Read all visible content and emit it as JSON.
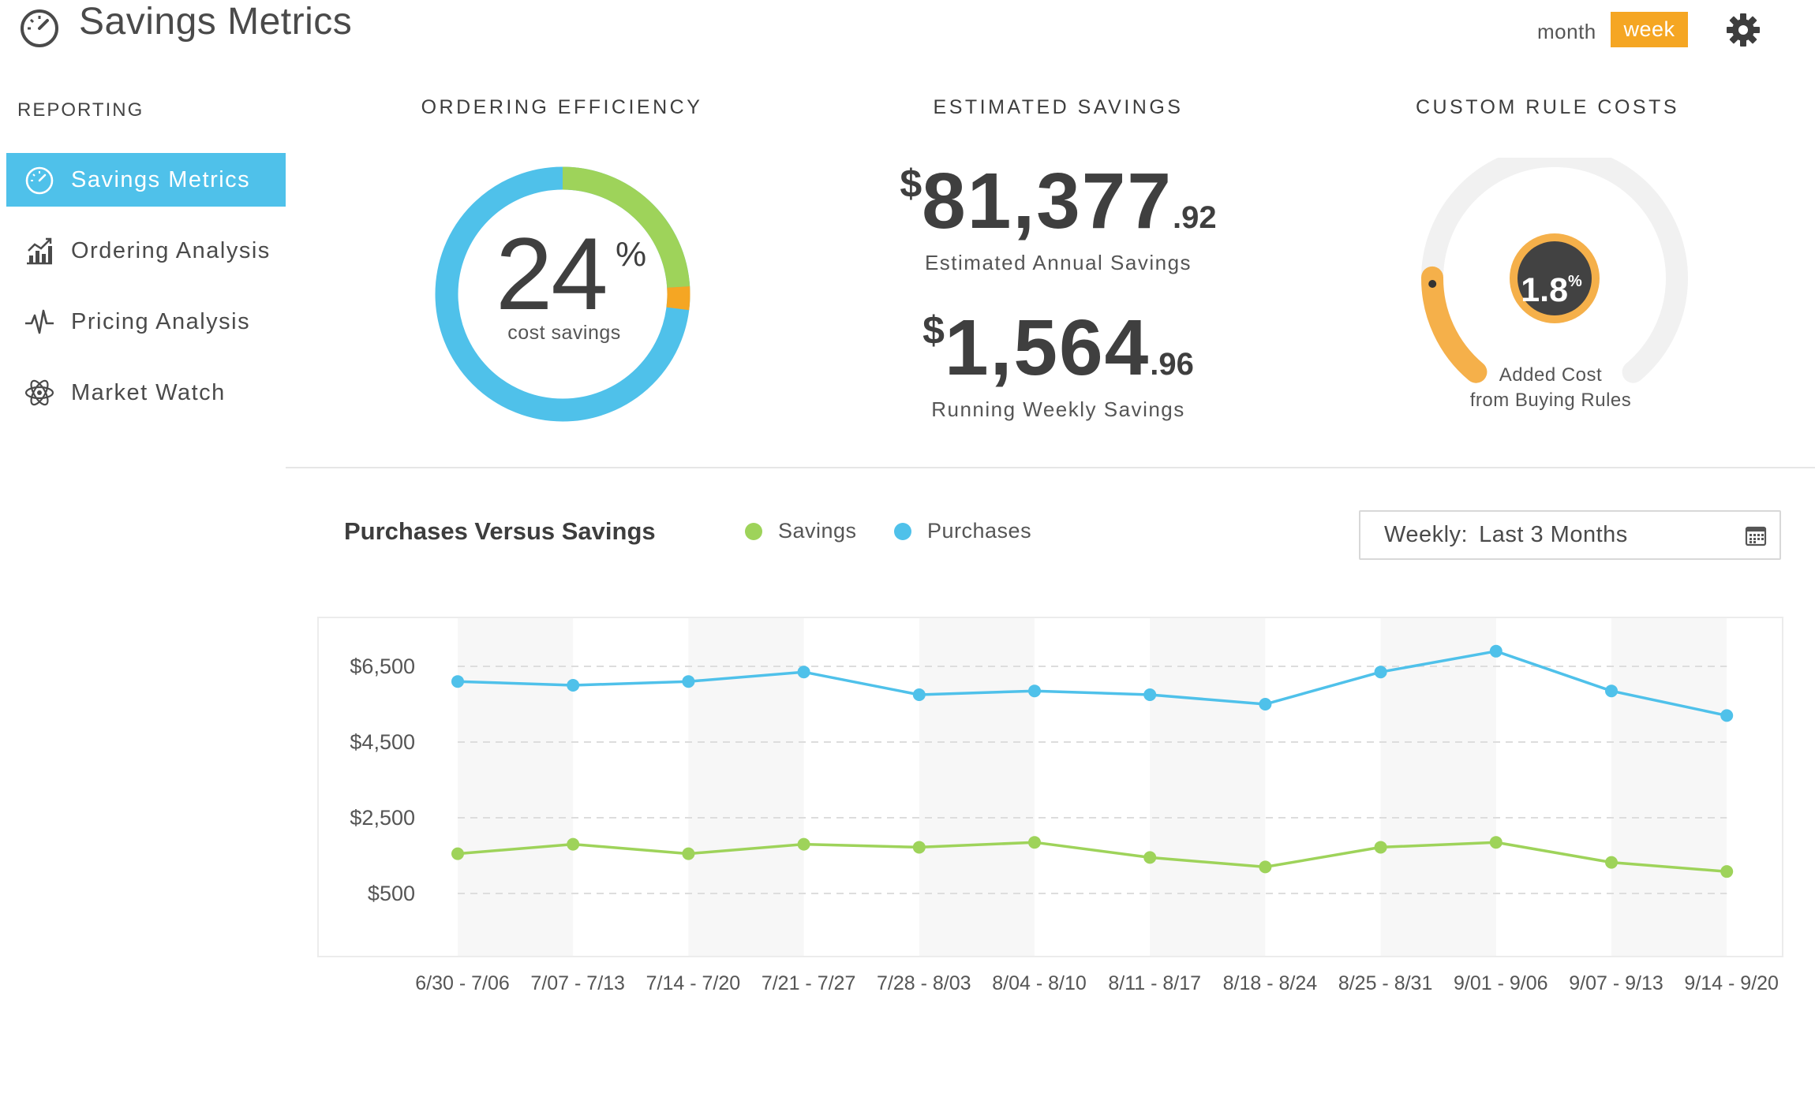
{
  "header": {
    "title": "Savings Metrics",
    "logo_icon": "speedometer-icon",
    "period_options": {
      "month": "month",
      "week": "week"
    },
    "active_period": "week",
    "settings_icon": "gear-icon"
  },
  "sidebar": {
    "heading": "REPORTING",
    "items": [
      {
        "label": "Savings Metrics",
        "icon": "speedometer-icon",
        "active": true
      },
      {
        "label": "Ordering Analysis",
        "icon": "bar-chart-icon",
        "active": false
      },
      {
        "label": "Pricing Analysis",
        "icon": "pulse-icon",
        "active": false
      },
      {
        "label": "Market Watch",
        "icon": "atom-icon",
        "active": false
      }
    ]
  },
  "ordering_efficiency": {
    "title": "ORDERING EFFICIENCY",
    "value": "24",
    "unit": "%",
    "caption": "cost savings",
    "ring": {
      "savings_fraction": 0.24,
      "marker_fraction": 0.03
    }
  },
  "estimated_savings": {
    "title": "ESTIMATED SAVINGS",
    "annual": {
      "symbol": "$",
      "whole": "81,377",
      "cents": ".92",
      "caption": "Estimated Annual Savings"
    },
    "weekly": {
      "symbol": "$",
      "whole": "1,564",
      "cents": ".96",
      "caption": "Running Weekly Savings"
    }
  },
  "custom_rule_costs": {
    "title": "CUSTOM RULE COSTS",
    "value": "1.8",
    "unit": "%",
    "caption_line1": "Added Cost",
    "caption_line2": "from Buying Rules",
    "gauge_fill_fraction": 0.18
  },
  "chart_section": {
    "title": "Purchases Versus Savings",
    "range_label": "Weekly:",
    "range_value": "Last 3 Months",
    "calendar_icon": "calendar-icon"
  },
  "colors": {
    "accent_blue": "#4fc1ea",
    "accent_orange": "#f5a623",
    "savings_green": "#9ed35a",
    "text_dark": "#3f3f3f"
  },
  "chart_data": {
    "type": "line",
    "title": "Purchases Versus Savings",
    "xlabel": "",
    "ylabel": "",
    "categories": [
      "6/30 - 7/06",
      "7/07 - 7/13",
      "7/14 - 7/20",
      "7/21 - 7/27",
      "7/28 - 8/03",
      "8/04 - 8/10",
      "8/11 - 8/17",
      "8/18 - 8/24",
      "8/25 - 8/31",
      "9/01 - 9/06",
      "9/07 - 9/13",
      "9/14 - 9/20"
    ],
    "yticks": [
      500,
      2500,
      4500,
      6500
    ],
    "ytick_labels": [
      "$500",
      "$2,500",
      "$4,500",
      "$6,500"
    ],
    "ylim": [
      -500,
      7800
    ],
    "grid": true,
    "legend_position": "top",
    "series": [
      {
        "name": "Savings",
        "color": "#9ed35a",
        "values": [
          1550,
          1800,
          1550,
          1800,
          1720,
          1850,
          1450,
          1200,
          1720,
          1850,
          1320,
          1080
        ]
      },
      {
        "name": "Purchases",
        "color": "#4fc1ea",
        "values": [
          6100,
          6000,
          6100,
          6350,
          5750,
          5850,
          5750,
          5500,
          6350,
          6900,
          5850,
          5200
        ]
      }
    ]
  }
}
